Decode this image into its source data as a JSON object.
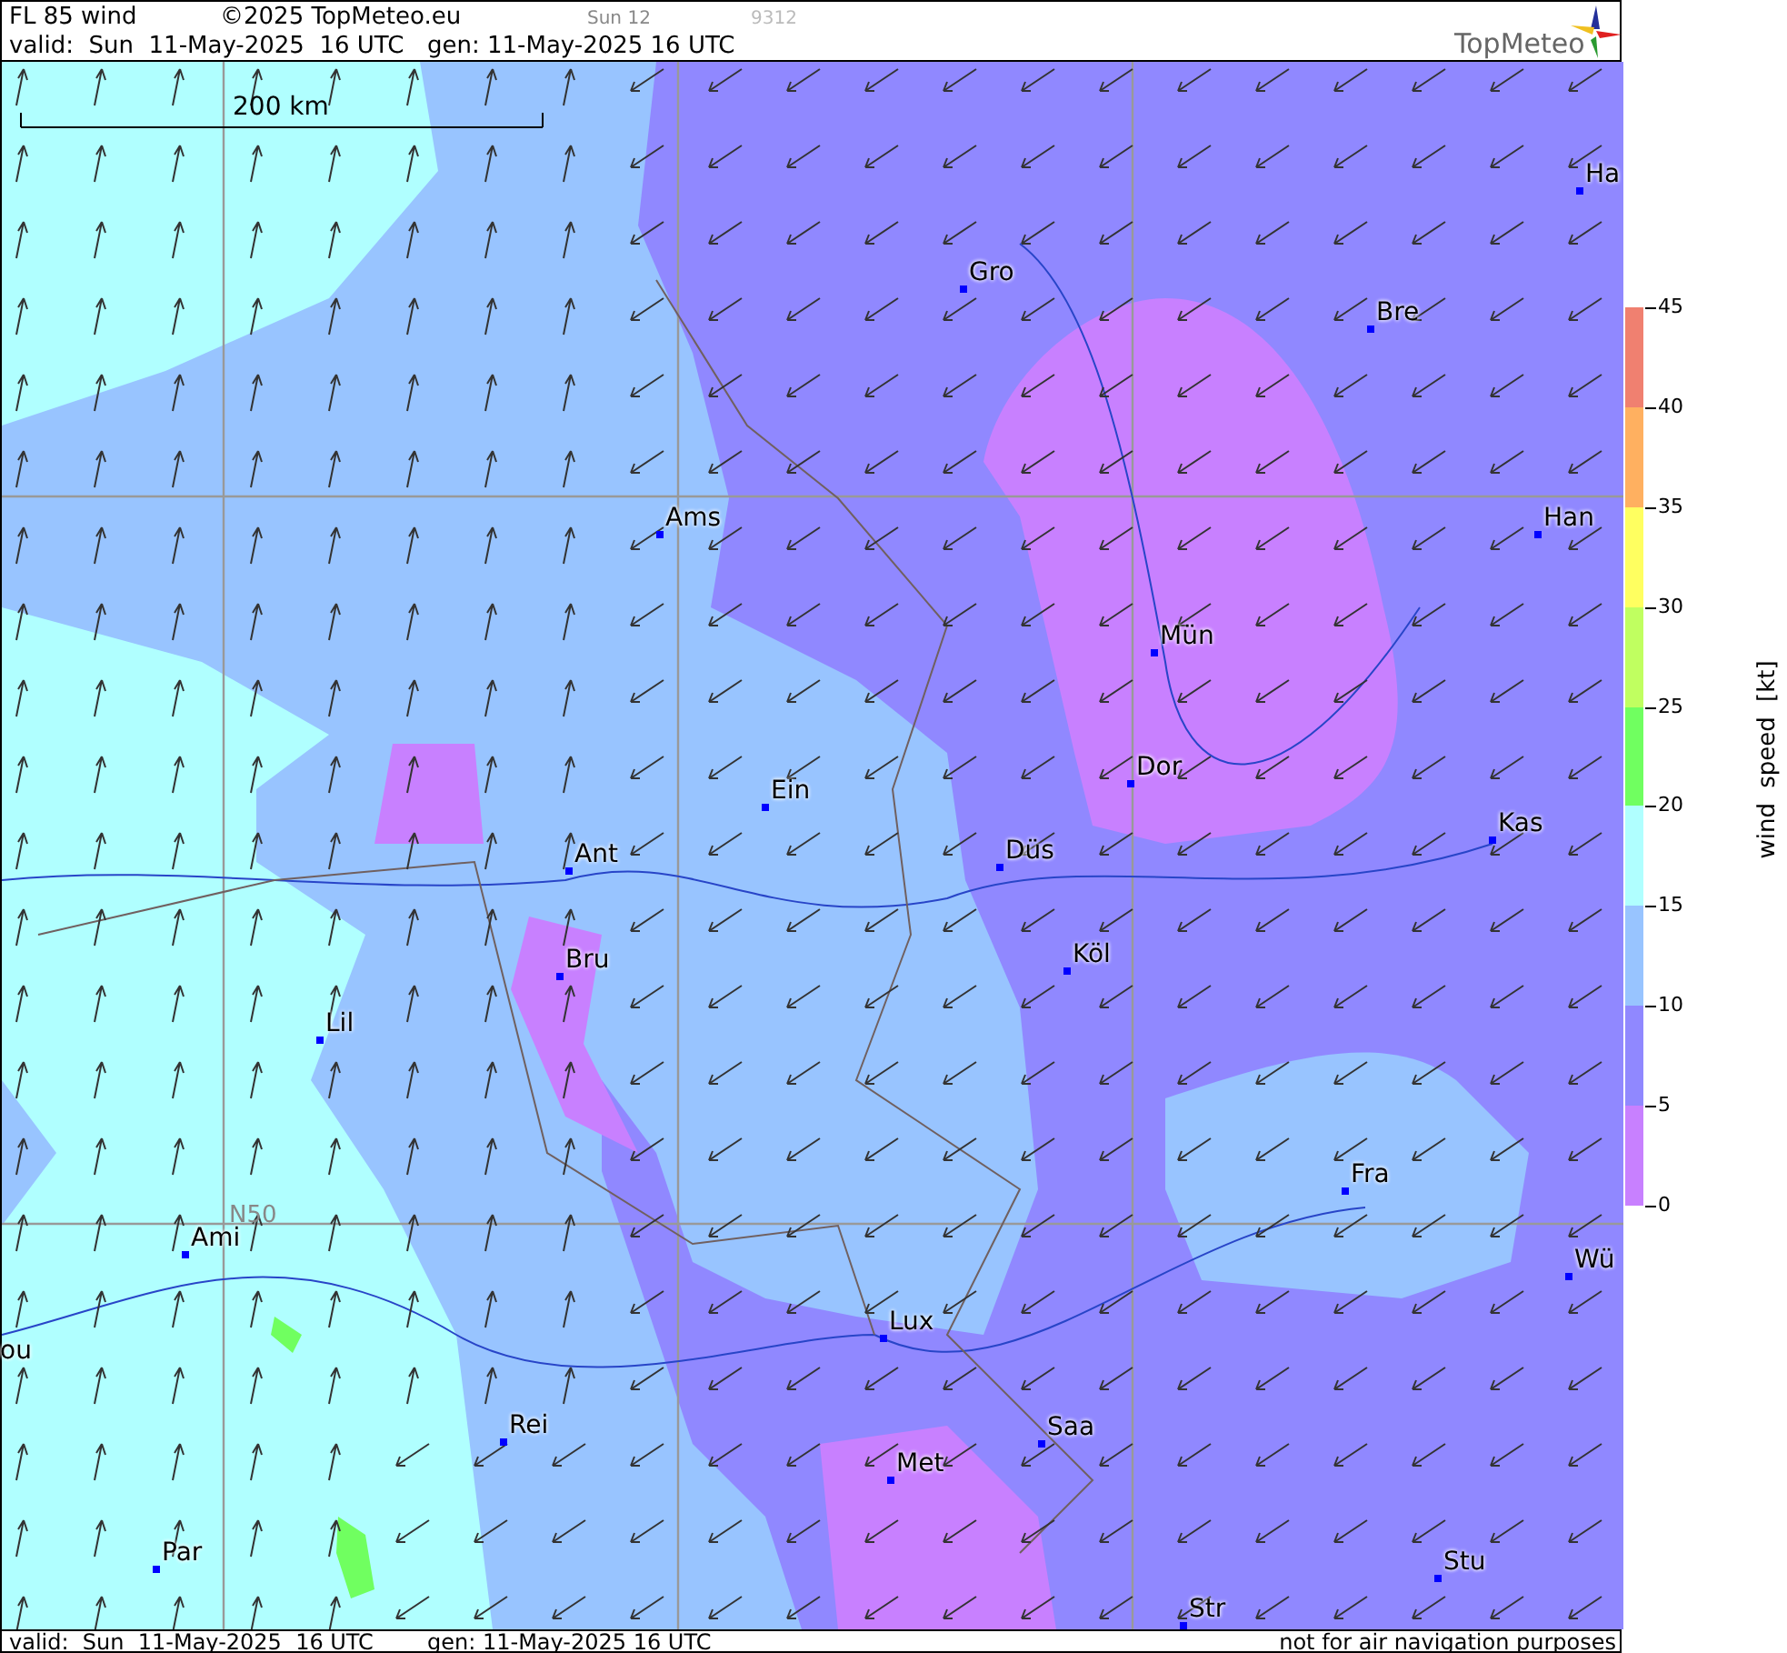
{
  "header": {
    "title": "FL 85 wind",
    "copyright": "©2025 TopMeteo.eu",
    "day": "Sun 12",
    "code": "9312",
    "valid": "valid:  Sun  11-May-2025  16 UTC",
    "generated": "gen: 11-May-2025 16 UTC",
    "logo": "TopMeteo"
  },
  "map": {
    "scale_label": "200 km",
    "grid_label": "N50",
    "cities": [
      {
        "name": "Ha"
      },
      {
        "name": "Gro"
      },
      {
        "name": "Bre"
      },
      {
        "name": "Ams"
      },
      {
        "name": "Han"
      },
      {
        "name": "Mün"
      },
      {
        "name": "Dor"
      },
      {
        "name": "Ein"
      },
      {
        "name": "Kas"
      },
      {
        "name": "Ant"
      },
      {
        "name": "Düs"
      },
      {
        "name": "Köl"
      },
      {
        "name": "Bru"
      },
      {
        "name": "Lil"
      },
      {
        "name": "Fra"
      },
      {
        "name": "Ami"
      },
      {
        "name": "Wü"
      },
      {
        "name": "ou"
      },
      {
        "name": "Lux"
      },
      {
        "name": "Rei"
      },
      {
        "name": "Saa"
      },
      {
        "name": "Met"
      },
      {
        "name": "Par"
      },
      {
        "name": "Stu"
      },
      {
        "name": "Str"
      }
    ]
  },
  "legend": {
    "title": "wind speed [kt]",
    "ticks": [
      "45",
      "40",
      "35",
      "30",
      "25",
      "20",
      "15",
      "10",
      "5",
      "0"
    ],
    "bands": [
      {
        "color": "#f08070"
      },
      {
        "color": "#ffb060"
      },
      {
        "color": "#ffff60"
      },
      {
        "color": "#c0ff60"
      },
      {
        "color": "#70ff60"
      },
      {
        "color": "#b0ffff"
      },
      {
        "color": "#98c4ff"
      },
      {
        "color": "#9088ff"
      },
      {
        "color": "#c880ff"
      }
    ]
  },
  "footer": {
    "valid": "valid:  Sun  11-May-2025  16 UTC",
    "generated": "gen: 11-May-2025 16 UTC",
    "notice": "not for air navigation purposes"
  }
}
